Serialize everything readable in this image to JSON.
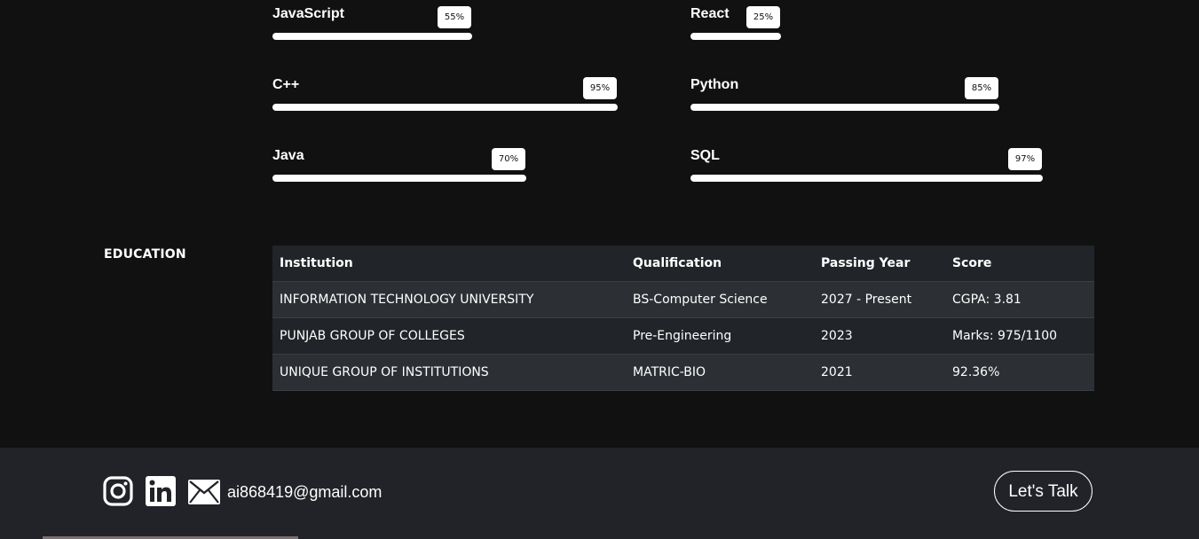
{
  "skills": [
    {
      "name": "JavaScript",
      "percent_label": "55%",
      "level": 0.55
    },
    {
      "name": "React",
      "percent_label": "25%",
      "level": 0.25
    },
    {
      "name": "C++",
      "percent_label": "95%",
      "level": 0.95
    },
    {
      "name": "Python",
      "percent_label": "85%",
      "level": 0.85
    },
    {
      "name": "Java",
      "percent_label": "70%",
      "level": 0.7
    },
    {
      "name": "SQL",
      "percent_label": "97%",
      "level": 0.97
    }
  ],
  "education": {
    "label": "EDUCATION",
    "headers": [
      "Institution",
      "Qualification",
      "Passing Year",
      "Score"
    ],
    "rows": [
      [
        "INFORMATION TECHNOLOGY UNIVERSITY",
        "BS-Computer Science",
        "2027 - Present",
        "CGPA: 3.81"
      ],
      [
        "PUNJAB GROUP OF COLLEGES",
        "Pre-Engineering",
        "2023",
        "Marks: 975/1100"
      ],
      [
        "UNIQUE GROUP OF INSTITUTIONS",
        "MATRIC-BIO",
        "2021",
        "92.36%"
      ]
    ]
  },
  "footer": {
    "icons": [
      "instagram-icon",
      "linkedin-icon",
      "mail-icon"
    ],
    "email": "ai868419@gmail.com",
    "cta_label": "Let's Talk"
  },
  "colors": {
    "background": "#111112",
    "footer_background": "#212328",
    "table_row_dark": "#212529",
    "table_row_light": "#2c3034",
    "bar": "#ffffff"
  }
}
